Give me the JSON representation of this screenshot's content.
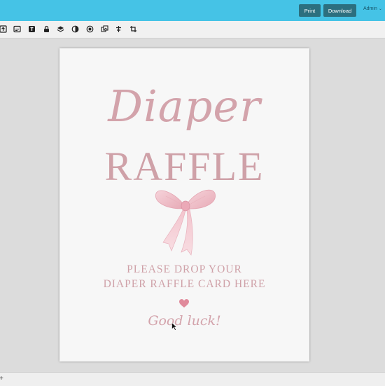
{
  "topbar": {
    "print_label": "Print",
    "download_label": "Download",
    "admin_label": "Admin",
    "accent_color": "#45c3e6"
  },
  "toolbar": {
    "tools": [
      "upload-icon",
      "layers-icon",
      "text-box-icon",
      "lock-icon",
      "stack-icon",
      "contrast-icon",
      "color-wheel-icon",
      "image-swap-icon",
      "align-icon",
      "crop-icon"
    ]
  },
  "document": {
    "title_script": "Diaper",
    "title_block": "RAFFLE",
    "instruction_line1": "PLEASE DROP YOUR",
    "instruction_line2": "DIAPER RAFFLE CARD HERE",
    "sign_off": "Good luck!",
    "text_color": "#cfa1a8",
    "bow_color": "#f0c6cf"
  },
  "bottombar": {
    "add_label": "+"
  }
}
